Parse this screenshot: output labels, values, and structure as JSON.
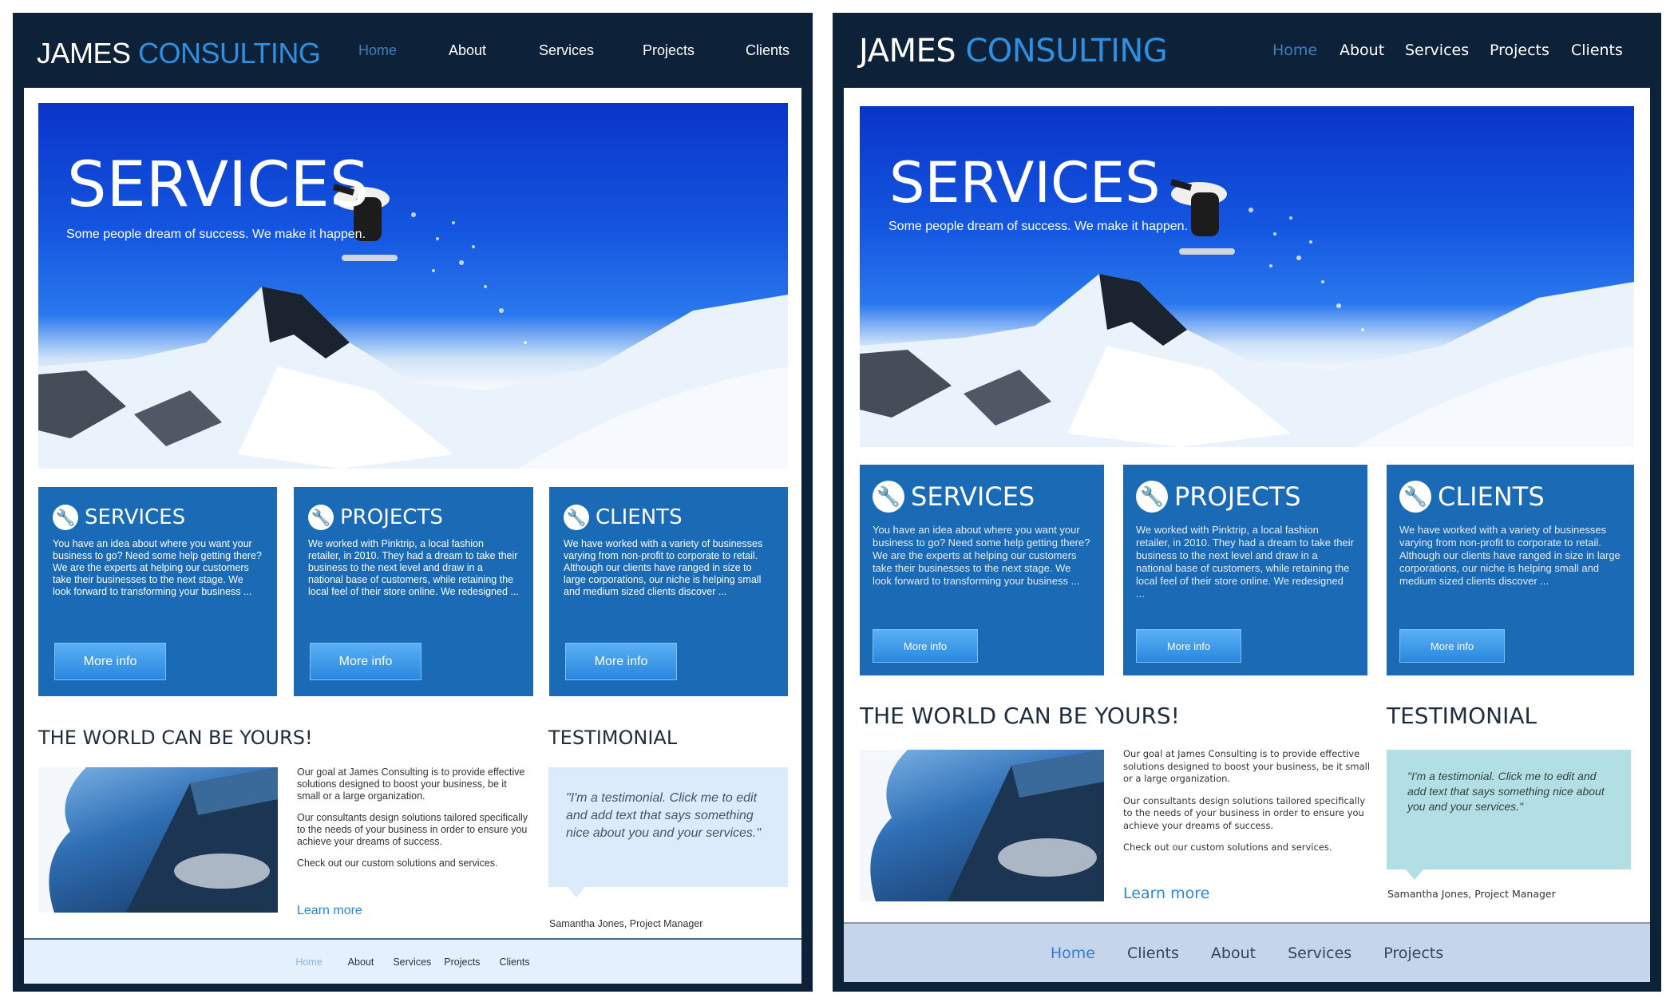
{
  "left": {
    "logo": {
      "part1": "JAMES",
      "part2": "CONSULTING"
    },
    "nav": [
      {
        "label": "Home",
        "active": true
      },
      {
        "label": "About"
      },
      {
        "label": "Services"
      },
      {
        "label": "Projects"
      },
      {
        "label": "Clients"
      }
    ],
    "hero": {
      "title": "SERVICES",
      "subtitle": "Some people dream of success. We make it happen."
    },
    "cards": [
      {
        "title": "SERVICES",
        "text": "You have an idea about where you want your business to go? Need some help getting there? We are the experts at helping our customers take their businesses to the next stage. We look forward to transforming your business ...",
        "button": "More info"
      },
      {
        "title": "PROJECTS",
        "text": "We worked with Pinktrip, a local fashion retailer, in 2010. They had a dream to take their business to the next level and draw in a national base of customers, while retaining the local feel of their store online. We redesigned ...",
        "button": "More info"
      },
      {
        "title": "CLIENTS",
        "text": "We have worked with a variety of businesses varying from non-profit to corporate to retail. Although our clients have ranged in size to large corporations, our niche is helping small and medium sized clients discover ...",
        "button": "More info"
      }
    ],
    "world": {
      "title": "THE WORLD CAN BE YOURS!",
      "p1": "Our goal at James Consulting is to provide effective solutions designed to boost your business, be it small or a large organization.",
      "p2": "Our consultants design solutions tailored specifically to the needs of your business in order to ensure you achieve your dreams of success.",
      "p3": "Check out our custom solutions and services.",
      "learn": "Learn more"
    },
    "testimonial": {
      "title": "TESTIMONIAL",
      "quote": "\"I'm a testimonial. Click me to edit and add text that says something nice about you and your services.\"",
      "author": "Samantha Jones, Project Manager"
    },
    "footer": [
      {
        "label": "Home",
        "active": true
      },
      {
        "label": "About"
      },
      {
        "label": "Services"
      },
      {
        "label": "Projects"
      },
      {
        "label": "Clients"
      }
    ]
  },
  "right": {
    "logo": {
      "part1": "JAMES",
      "part2": "CONSULTING"
    },
    "nav": [
      {
        "label": "Home",
        "active": true
      },
      {
        "label": "About"
      },
      {
        "label": "Services"
      },
      {
        "label": "Projects"
      },
      {
        "label": "Clients"
      }
    ],
    "hero": {
      "title": "SERVICES",
      "subtitle": "Some people dream of success. We make it happen."
    },
    "cards": [
      {
        "title": "SERVICES",
        "text": "You have an idea about where you want your business to go? Need some help getting there? We are the experts at helping our customers take their businesses to the next stage. We look forward to transforming your business ...",
        "button": "More info"
      },
      {
        "title": "PROJECTS",
        "text": "We worked with Pinktrip, a local fashion retailer, in 2010. They had a dream to take their business to the next level and draw in a national base of customers, while retaining the local feel of their store online. We redesigned ...",
        "button": "More info"
      },
      {
        "title": "CLIENTS",
        "text": "We have worked with a variety of businesses varying from non-profit to corporate to retail. Although our clients have ranged in size in large corporations, our niche is helping small and medium sized clients discover ...",
        "button": "More info"
      }
    ],
    "world": {
      "title": "THE WORLD CAN BE YOURS!",
      "p1": "Our goal at James Consulting is to provide effective solutions designed to boost your business, be it small or a large organization.",
      "p2": "Our consultants design solutions tailored specifically to the needs of your business in order to ensure you achieve your dreams of success.",
      "p3": "Check out our custom solutions and services.",
      "learn": "Learn more"
    },
    "testimonial": {
      "title": "TESTIMONIAL",
      "quote": "\"I'm a testimonial. Click me to edit and add text that says something nice about you and your services.\"",
      "author": "Samantha Jones, Project Manager"
    },
    "footer": [
      {
        "label": "Home",
        "active": true
      },
      {
        "label": "Clients"
      },
      {
        "label": "About"
      },
      {
        "label": "Services"
      },
      {
        "label": "Projects"
      }
    ]
  },
  "colors": {
    "frame": "#0d2138",
    "accent": "#2f8fe0",
    "card": "#1a6ab5",
    "left_bubble": "#dcebfb",
    "right_bubble": "#b2dfe4",
    "left_footer": "#e4f0fd",
    "right_footer": "#c5d5ec"
  }
}
